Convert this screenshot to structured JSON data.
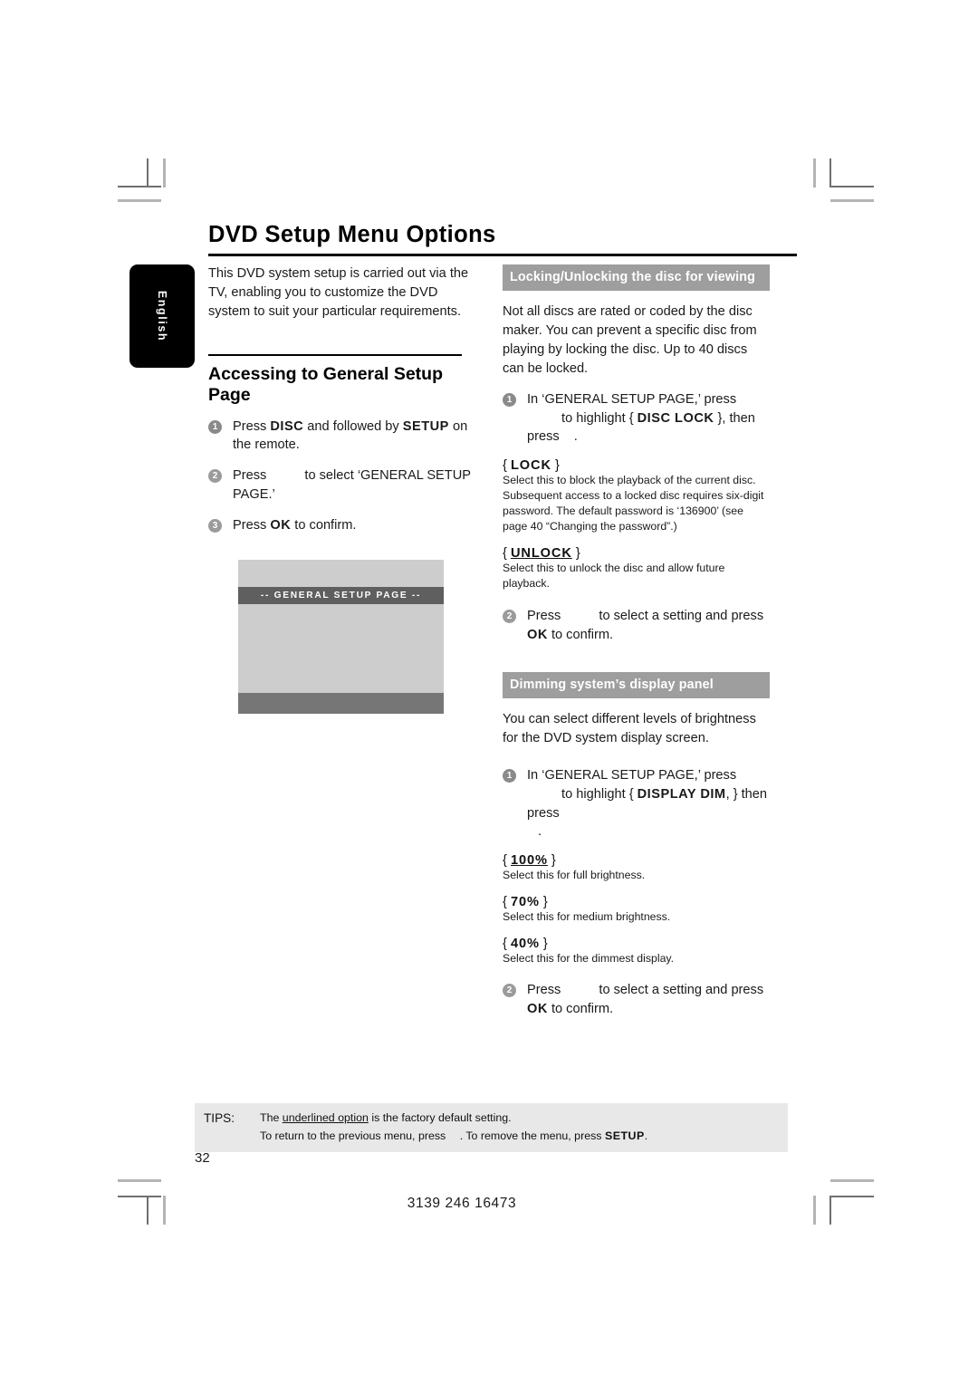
{
  "document": {
    "page_title": "DVD Setup Menu Options",
    "language_tab": "English",
    "page_number": "32",
    "doc_code": "3139 246 16473"
  },
  "left_column": {
    "intro": "This DVD system setup is carried out via the TV, enabling you to customize the DVD system to suit your particular requirements.",
    "section_heading": "Accessing to General Setup Page",
    "steps": [
      {
        "number": "1",
        "parts": [
          {
            "t": "Press ",
            "style": "normal"
          },
          {
            "t": "DISC",
            "style": "bold"
          },
          {
            "t": " and followed by ",
            "style": "normal"
          },
          {
            "t": "SETUP",
            "style": "bold"
          },
          {
            "t": " on the remote.",
            "style": "normal"
          }
        ]
      },
      {
        "number": "2",
        "parts": [
          {
            "t": "Press ",
            "style": "normal"
          },
          {
            "t": "",
            "style": "gap"
          },
          {
            "t": " to select ‘GENERAL SETUP PAGE.’",
            "style": "normal"
          }
        ]
      },
      {
        "number": "3",
        "parts": [
          {
            "t": "Press ",
            "style": "normal"
          },
          {
            "t": "OK",
            "style": "bold"
          },
          {
            "t": " to confirm.",
            "style": "normal"
          }
        ]
      }
    ],
    "osd_screenshot": {
      "titlebar": "-- GENERAL SETUP PAGE --"
    }
  },
  "right_column": {
    "section_lock": {
      "header": "Locking/Unlocking the disc for viewing",
      "intro": "Not all discs are rated or coded by the disc maker. You can prevent a specific disc from playing by locking the disc. Up to 40 discs can be locked.",
      "step1_number": "1",
      "step1_a": "In ‘GENERAL SETUP PAGE,’ press ",
      "step1_b": " to highlight { ",
      "step1_key": "DISC LOCK",
      "step1_c": " }, then press ",
      "step1_d": ".",
      "options": [
        {
          "label": "LOCK",
          "underlined": false,
          "description": "Select this to block the playback of the current disc. Subsequent access to a locked disc requires six-digit password. The default password is ‘136900’ (see page 40 “Changing the password”.)"
        },
        {
          "label": "UNLOCK",
          "underlined": true,
          "description": "Select this to unlock the disc and allow future playback."
        }
      ],
      "step2_number": "2",
      "step2_a": "Press ",
      "step2_b": " to select a setting and press ",
      "step2_key": "OK",
      "step2_c": " to confirm."
    },
    "section_dim": {
      "header": "Dimming system’s display panel",
      "intro": "You can select different levels of brightness for the DVD system display screen.",
      "step1_number": "1",
      "step1_a": "In ‘GENERAL SETUP PAGE,’ press ",
      "step1_b": " to highlight { ",
      "step1_key": "DISPLAY DIM",
      "step1_c": ", } then press",
      "step1_d": ".",
      "options": [
        {
          "label": "100%",
          "underlined": true,
          "description": "Select this for full brightness."
        },
        {
          "label": "70%",
          "underlined": false,
          "description": "Select this for medium brightness."
        },
        {
          "label": "40%",
          "underlined": false,
          "description": "Select this for the dimmest display."
        }
      ],
      "step2_number": "2",
      "step2_a": "Press ",
      "step2_b": " to select a setting and press ",
      "step2_key": "OK",
      "step2_c": " to confirm."
    }
  },
  "tips": {
    "label": "TIPS:",
    "line1_a": "The ",
    "line1_underlined": "underlined option",
    "line1_b": " is the factory default setting.",
    "line2_a": "To return to the previous menu, press ",
    "line2_b": ". To remove the menu, press ",
    "line2_key": "SETUP",
    "line2_c": "."
  }
}
